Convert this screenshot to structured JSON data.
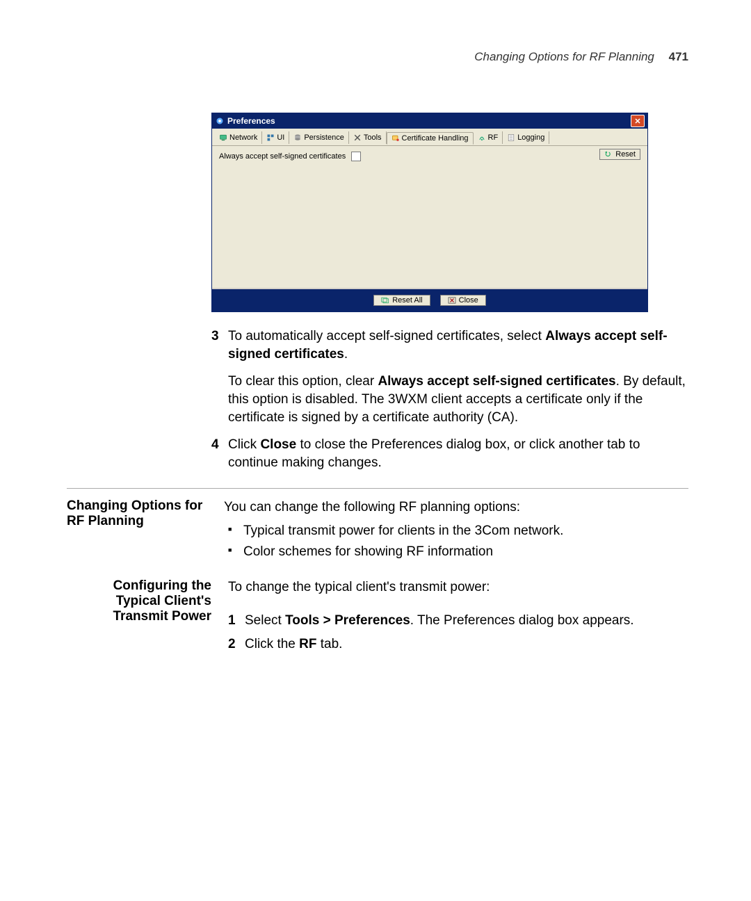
{
  "header": {
    "title": "Changing Options for RF Planning",
    "page_number": "471"
  },
  "dialog": {
    "title": "Preferences",
    "tabs": [
      "Network",
      "UI",
      "Persistence",
      "Tools",
      "Certificate Handling",
      "RF",
      "Logging"
    ],
    "active_tab_index": 4,
    "checkbox_label": "Always accept self-signed certificates",
    "reset_label": "Reset",
    "reset_all_label": "Reset All",
    "close_label": "Close"
  },
  "body": {
    "step3": {
      "num": "3",
      "pre": "To automatically accept self-signed certificates, select ",
      "bold": "Always accept self-signed certificates",
      "post": "."
    },
    "step3_note": {
      "pre": "To clear this option, clear ",
      "bold": "Always accept self-signed certificates",
      "post": ". By default, this option is disabled. The 3WXM client accepts a certificate only if the certificate is signed by a certificate authority (CA)."
    },
    "step4": {
      "num": "4",
      "pre": "Click ",
      "bold": "Close",
      "post": " to close the Preferences dialog box, or click another tab to continue making changes."
    },
    "section1": {
      "heading": "Changing Options for RF Planning",
      "intro": "You can change the following RF planning options:",
      "bullets": [
        "Typical transmit power for clients in the 3Com network.",
        "Color schemes for showing RF information"
      ]
    },
    "section2": {
      "heading": "Configuring the Typical Client's Transmit Power",
      "intro": "To change the typical client's transmit power:",
      "s1": {
        "num": "1",
        "pre": "Select ",
        "bold": "Tools > Preferences",
        "post": ". The Preferences dialog box appears."
      },
      "s2": {
        "num": "2",
        "pre": "Click the ",
        "bold": "RF",
        "post": " tab."
      }
    }
  }
}
